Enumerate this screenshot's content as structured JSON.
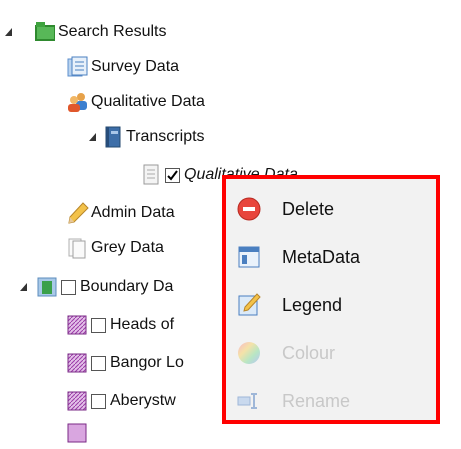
{
  "tree": {
    "items": [
      {
        "label": "Search Results",
        "icon": "green-folder-icon",
        "expanded": true
      },
      {
        "label": "Survey Data",
        "icon": "survey-data-icon"
      },
      {
        "label": "Qualitative Data",
        "icon": "people-icon"
      },
      {
        "label": "Transcripts",
        "icon": "book-icon",
        "expanded": true
      },
      {
        "label": "Qualitative Data",
        "icon": "document-icon",
        "checked": true
      },
      {
        "label": "Admin Data",
        "icon": "pencil-icon"
      },
      {
        "label": "Grey Data",
        "icon": "grey-pages-icon"
      },
      {
        "label": "Boundary Da",
        "icon": "boundary-layer-icon",
        "expanded": true,
        "checked": false
      },
      {
        "label": "Heads of",
        "icon": "purple-hatch-icon",
        "checked": false
      },
      {
        "label": "Bangor Lo",
        "icon": "purple-hatch-icon",
        "checked": false
      },
      {
        "label": "Aberystw",
        "icon": "purple-hatch-icon",
        "checked": false
      }
    ]
  },
  "context_menu": {
    "highlight_color": "#ff0000",
    "items": [
      {
        "label": "Delete",
        "icon": "delete-icon",
        "enabled": true
      },
      {
        "label": "MetaData",
        "icon": "metadata-icon",
        "enabled": true
      },
      {
        "label": "Legend",
        "icon": "legend-icon",
        "enabled": true
      },
      {
        "label": "Colour",
        "icon": "colour-wheel-icon",
        "enabled": false
      },
      {
        "label": "Rename",
        "icon": "rename-icon",
        "enabled": false
      }
    ]
  }
}
